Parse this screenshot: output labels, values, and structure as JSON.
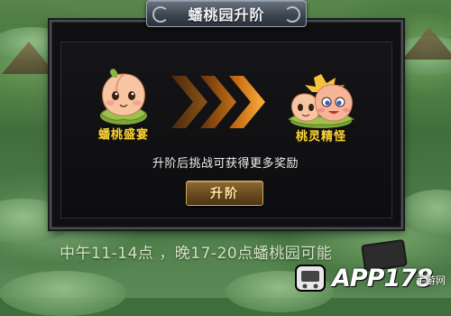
{
  "dialog": {
    "title": "蟠桃园升阶",
    "from_label": "蟠桃盛宴",
    "to_label": "桃灵精怪",
    "description": "升阶后挑战可获得更多奖励",
    "upgrade_button": "升阶"
  },
  "background": {
    "ticker_text": "中午11-14点 ，晚17-20点蟠桃园可能"
  },
  "watermark": {
    "brand": "APP178",
    "sub": "手游网"
  },
  "icons": {
    "from_character": "peach-spirit-icon",
    "to_character": "peach-spirit-pair-icon",
    "arrows": "triple-chevron-right-icon",
    "phone": "phone-icon"
  },
  "colors": {
    "label_gold": "#f3d23a",
    "arrow_orange": "#e07a12",
    "button_brown": "#6b4d20"
  }
}
